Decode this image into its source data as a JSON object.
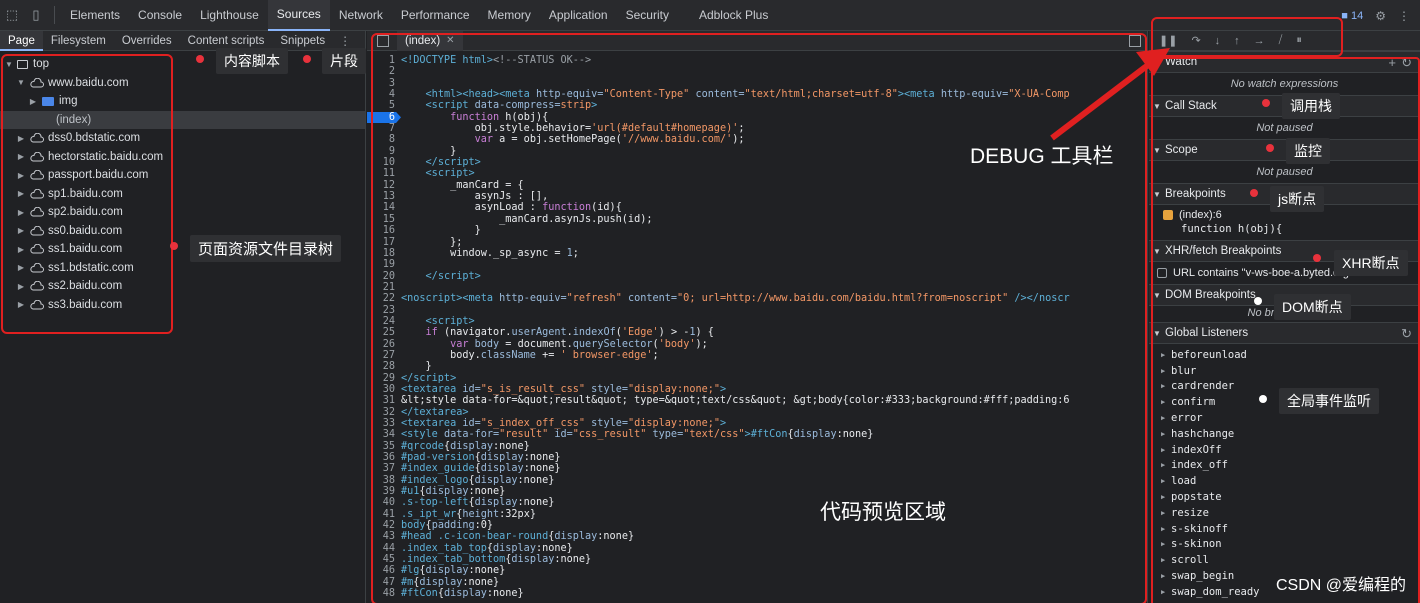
{
  "toolbar": {
    "tabs": [
      "Elements",
      "Console",
      "Lighthouse",
      "Sources",
      "Network",
      "Performance",
      "Memory",
      "Application",
      "Security",
      "Adblock Plus"
    ],
    "active_tab": "Sources",
    "issues_count": "14"
  },
  "navigator": {
    "tabs": [
      "Page",
      "Filesystem",
      "Overrides",
      "Content scripts",
      "Snippets"
    ],
    "tree": [
      {
        "label": "top",
        "level": 0,
        "kind": "frame",
        "expanded": true
      },
      {
        "label": "www.baidu.com",
        "level": 1,
        "kind": "cloud",
        "expanded": true
      },
      {
        "label": "img",
        "level": 2,
        "kind": "folder",
        "expanded": false
      },
      {
        "label": "(index)",
        "level": 2,
        "kind": "file",
        "selected": true
      },
      {
        "label": "dss0.bdstatic.com",
        "level": 1,
        "kind": "cloud"
      },
      {
        "label": "hectorstatic.baidu.com",
        "level": 1,
        "kind": "cloud"
      },
      {
        "label": "passport.baidu.com",
        "level": 1,
        "kind": "cloud"
      },
      {
        "label": "sp1.baidu.com",
        "level": 1,
        "kind": "cloud"
      },
      {
        "label": "sp2.baidu.com",
        "level": 1,
        "kind": "cloud"
      },
      {
        "label": "ss0.baidu.com",
        "level": 1,
        "kind": "cloud"
      },
      {
        "label": "ss1.baidu.com",
        "level": 1,
        "kind": "cloud"
      },
      {
        "label": "ss1.bdstatic.com",
        "level": 1,
        "kind": "cloud"
      },
      {
        "label": "ss2.baidu.com",
        "level": 1,
        "kind": "cloud"
      },
      {
        "label": "ss3.baidu.com",
        "level": 1,
        "kind": "cloud"
      }
    ]
  },
  "editor": {
    "file_tab": "(index)",
    "breakpoint_line": 6,
    "lines": [
      {
        "n": 1,
        "h": "<span class=\"tag\">&lt;!DOCTYPE html&gt;</span><span class=\"cmt\">&lt;!--STATUS OK--&gt;</span>"
      },
      {
        "n": 2,
        "h": ""
      },
      {
        "n": 3,
        "h": ""
      },
      {
        "n": 4,
        "h": "    <span class=\"tag\">&lt;html&gt;&lt;head&gt;&lt;meta</span> <span class=\"att\">http-equiv=</span><span class=\"str\">\"Content-Type\"</span> <span class=\"att\">content=</span><span class=\"str\">\"text/html;charset=utf-8\"</span><span class=\"tag\">&gt;&lt;meta</span> <span class=\"att\">http-equiv=</span><span class=\"str\">\"X-UA-Comp</span>"
      },
      {
        "n": 5,
        "h": "    <span class=\"tag\">&lt;script</span> <span class=\"att\">data-compress=</span><span class=\"str\">strip</span><span class=\"tag\">&gt;</span>"
      },
      {
        "n": 6,
        "h": "        <span class=\"kw\">function</span> h(obj){"
      },
      {
        "n": 7,
        "h": "            obj.style.behavior=<span class=\"str\">'url(#default#homepage)'</span>;"
      },
      {
        "n": 8,
        "h": "            <span class=\"kw\">var</span> a = obj.setHomePage(<span class=\"str\">'//www.baidu.com/'</span>);"
      },
      {
        "n": 9,
        "h": "        }"
      },
      {
        "n": 10,
        "h": "    <span class=\"tag\">&lt;/script&gt;</span>"
      },
      {
        "n": 11,
        "h": "    <span class=\"tag\">&lt;script&gt;</span>"
      },
      {
        "n": 12,
        "h": "        _manCard = {"
      },
      {
        "n": 13,
        "h": "            asynJs : [],"
      },
      {
        "n": 14,
        "h": "            asynLoad : <span class=\"kw\">function</span>(id){"
      },
      {
        "n": 15,
        "h": "                _manCard.asynJs.push(id);"
      },
      {
        "n": 16,
        "h": "            }"
      },
      {
        "n": 17,
        "h": "        };"
      },
      {
        "n": 18,
        "h": "        window._sp_async = <span class=\"att\">1</span>;"
      },
      {
        "n": 19,
        "h": ""
      },
      {
        "n": 20,
        "h": "    <span class=\"tag\">&lt;/script&gt;</span>"
      },
      {
        "n": 21,
        "h": ""
      },
      {
        "n": 22,
        "h": "<span class=\"tag\">&lt;noscript&gt;&lt;meta</span> <span class=\"att\">http-equiv=</span><span class=\"str\">\"refresh\"</span> <span class=\"att\">content=</span><span class=\"str\">\"0; url=http://www.baidu.com/baidu.html?from=noscript\"</span> <span class=\"tag\">/&gt;&lt;/noscr</span>"
      },
      {
        "n": 23,
        "h": ""
      },
      {
        "n": 24,
        "h": "    <span class=\"tag\">&lt;script&gt;</span>"
      },
      {
        "n": 25,
        "h": "    <span class=\"kw\">if</span> (navigator.<span class=\"att\">userAgent</span>.<span class=\"att\">indexOf</span>(<span class=\"str\">'Edge'</span>) &gt; -<span class=\"att\">1</span>) {"
      },
      {
        "n": 26,
        "h": "        <span class=\"kw\">var</span> <span class=\"att\">body</span> = document.<span class=\"att\">querySelector</span>(<span class=\"str\">'body'</span>);"
      },
      {
        "n": 27,
        "h": "        body.<span class=\"att\">className</span> += <span class=\"str\">' browser-edge'</span>;"
      },
      {
        "n": 28,
        "h": "    }"
      },
      {
        "n": 29,
        "h": "<span class=\"tag\">&lt;/script&gt;</span>"
      },
      {
        "n": 30,
        "h": "<span class=\"tag\">&lt;textarea</span> <span class=\"att\">id=</span><span class=\"str\">\"s_is_result_css\"</span> <span class=\"att\">style=</span><span class=\"str\">\"display:none;\"</span><span class=\"tag\">&gt;</span>"
      },
      {
        "n": 31,
        "h": "&amp;lt;style data-for=&amp;quot;result&amp;quot; type=&amp;quot;text/css&amp;quot; &amp;gt;body{color:#333;background:#fff;padding:6"
      },
      {
        "n": 32,
        "h": "<span class=\"tag\">&lt;/textarea&gt;</span>"
      },
      {
        "n": 33,
        "h": "<span class=\"tag\">&lt;textarea</span> <span class=\"att\">id=</span><span class=\"str\">\"s_index_off_css\"</span> <span class=\"att\">style=</span><span class=\"str\">\"display:none;\"</span><span class=\"tag\">&gt;</span>"
      },
      {
        "n": 34,
        "h": "<span class=\"tag\">&lt;style</span> <span class=\"att\">data-for=</span><span class=\"str\">\"result\"</span> <span class=\"att\">id=</span><span class=\"str\">\"css_result\"</span> <span class=\"att\">type=</span><span class=\"str\">\"text/css\"</span><span class=\"tag\">&gt;</span><span class=\"sel2\">#ftCon</span>{<span class=\"att\">display</span>:none}"
      },
      {
        "n": 35,
        "h": "<span class=\"sel2\">#qrcode</span>{<span class=\"att\">display</span>:none}"
      },
      {
        "n": 36,
        "h": "<span class=\"sel2\">#pad-version</span>{<span class=\"att\">display</span>:none}"
      },
      {
        "n": 37,
        "h": "<span class=\"sel2\">#index_guide</span>{<span class=\"att\">display</span>:none}"
      },
      {
        "n": 38,
        "h": "<span class=\"sel2\">#index_logo</span>{<span class=\"att\">display</span>:none}"
      },
      {
        "n": 39,
        "h": "<span class=\"sel2\">#u1</span>{<span class=\"att\">display</span>:none}"
      },
      {
        "n": 40,
        "h": "<span class=\"sel2\">.s-top-left</span>{<span class=\"att\">display</span>:none}"
      },
      {
        "n": 41,
        "h": "<span class=\"sel2\">.s_ipt_wr</span>{<span class=\"att\">height</span>:32px}"
      },
      {
        "n": 42,
        "h": "<span class=\"sel2\">body</span>{<span class=\"att\">padding</span>:0}"
      },
      {
        "n": 43,
        "h": "<span class=\"sel2\">#head .c-icon-bear-round</span>{<span class=\"att\">display</span>:none}"
      },
      {
        "n": 44,
        "h": "<span class=\"sel2\">.index_tab_top</span>{<span class=\"att\">display</span>:none}"
      },
      {
        "n": 45,
        "h": "<span class=\"sel2\">.index_tab_bottom</span>{<span class=\"att\">display</span>:none}"
      },
      {
        "n": 46,
        "h": "<span class=\"sel2\">#lg</span>{<span class=\"att\">display</span>:none}"
      },
      {
        "n": 47,
        "h": "<span class=\"sel2\">#m</span>{<span class=\"att\">display</span>:none}"
      },
      {
        "n": 48,
        "h": "<span class=\"sel2\">#ftCon</span>{<span class=\"att\">display</span>:none}"
      }
    ]
  },
  "debugger": {
    "watch": {
      "title": "Watch",
      "note": "No watch expressions"
    },
    "call_stack": {
      "title": "Call Stack",
      "note": "Not paused"
    },
    "scope": {
      "title": "Scope",
      "note": "Not paused"
    },
    "breakpoints": {
      "title": "Breakpoints",
      "item_label": "(index):6",
      "item_code": "function h(obj){"
    },
    "xhr": {
      "title": "XHR/fetch Breakpoints",
      "item": "URL contains \"v-ws-boe-a.byted.org\""
    },
    "dom": {
      "title": "DOM Breakpoints",
      "note": "No breakpoints"
    },
    "global": {
      "title": "Global Listeners",
      "items": [
        "beforeunload",
        "blur",
        "cardrender",
        "confirm",
        "error",
        "hashchange",
        "indexOff",
        "index_off",
        "load",
        "popstate",
        "resize",
        "s-skinoff",
        "s-skinon",
        "scroll",
        "swap_begin",
        "swap_dom_ready"
      ]
    }
  },
  "annotations": {
    "content_scripts": "内容脚本",
    "snippets": "片段",
    "tree": "页面资源文件目录树",
    "debug_toolbar": "DEBUG 工具栏",
    "code_preview": "代码预览区域",
    "call_stack": "调用栈",
    "scope": "监控",
    "js_breakpoints": "js断点",
    "xhr_breakpoints": "XHR断点",
    "dom_breakpoints": "DOM断点",
    "global_listeners": "全局事件监听"
  },
  "watermark": "CSDN @爱编程的",
  "colors": {
    "highlight": "#e02020",
    "accent": "#8ab4f8",
    "breakpoint": "#1a73e8"
  }
}
